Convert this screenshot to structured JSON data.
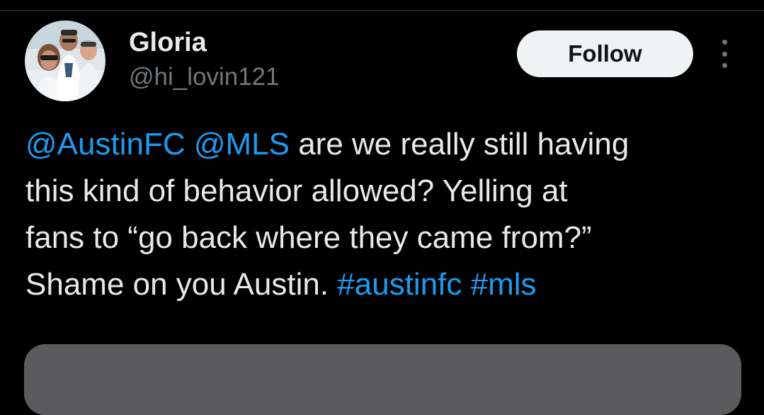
{
  "user": {
    "display_name": "Gloria",
    "handle": "@hi_lovin121",
    "avatar_icon": "profile-photo"
  },
  "actions": {
    "follow_label": "Follow",
    "more_icon": "more-vertical-icon"
  },
  "tweet": {
    "line1": {
      "mention1": "@AustinFC",
      "mention2": "@MLS",
      "text": " are we really still having"
    },
    "line2": "this kind of behavior allowed? Yelling at",
    "line3": "fans to “go back where they came from?”",
    "line4": {
      "text": "Shame on you Austin. ",
      "hashtag1": "#austinfc",
      "hashtag2": "#mls"
    }
  },
  "colors": {
    "background": "#000000",
    "text": "#e7e9ea",
    "secondary_text": "#71767b",
    "link": "#1d9bf0",
    "follow_bg": "#eff3f4",
    "media_placeholder": "#5b5b5d"
  }
}
